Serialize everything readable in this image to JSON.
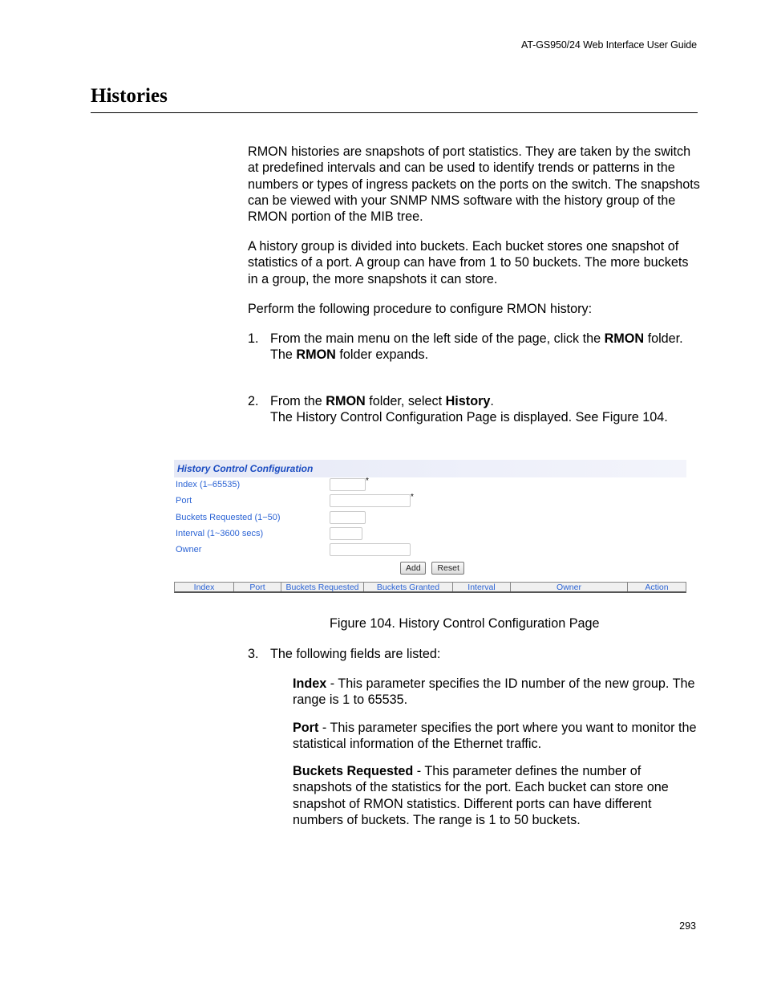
{
  "running_header": "AT-GS950/24  Web Interface User Guide",
  "section_title": "Histories",
  "paragraphs": [
    "RMON histories are snapshots of port statistics. They are taken by the switch at predefined intervals and can be used to identify trends or patterns in the numbers or types of ingress packets on the ports on the switch. The snapshots can be viewed with your SNMP NMS software with the history group of the RMON portion of the MIB tree.",
    "A history group is divided into buckets. Each bucket stores one snapshot of statistics of a port. A group can have from 1 to 50 buckets. The more buckets in a group, the more snapshots it can store.",
    "Perform the following procedure to configure RMON history:"
  ],
  "steps": [
    {
      "number": "1.",
      "line1_pre": "From the main menu on the left side of the page, click the ",
      "line1_bold": "RMON",
      "line1_post": " folder.",
      "line2_pre": "The ",
      "line2_bold": "RMON",
      "line2_post": " folder expands."
    },
    {
      "number": "2.",
      "line1_pre": "From the ",
      "line1_bold": "RMON",
      "line1_mid": " folder, select ",
      "line1_bold2": "History",
      "line1_post": ".",
      "line2": "The History Control Configuration Page is displayed. See Figure 104."
    },
    {
      "number": "3.",
      "text": "The following fields are listed:"
    }
  ],
  "figure": {
    "header": "History Control Configuration",
    "fields": [
      {
        "label": "Index (1–65535)",
        "value": "",
        "required": "*"
      },
      {
        "label": "Port",
        "value": "",
        "required": "*"
      },
      {
        "label": "Buckets Requested (1−50)",
        "value": "",
        "required": ""
      },
      {
        "label": "Interval (1~3600 secs)",
        "value": "",
        "required": ""
      },
      {
        "label": "Owner",
        "value": "",
        "required": ""
      }
    ],
    "buttons": {
      "add": "Add",
      "reset": "Reset"
    },
    "table_columns": [
      "Index",
      "Port",
      "Buckets Requested",
      "Buckets Granted",
      "Interval",
      "Owner",
      "Action"
    ],
    "caption": "Figure 104. History Control Configuration Page"
  },
  "field_descriptions": [
    {
      "term": "Index",
      "text": " - This parameter specifies the ID number of the new group. The range is 1 to 65535."
    },
    {
      "term": "Port",
      "text": " - This parameter specifies the port where you want to monitor the statistical information of the Ethernet traffic."
    },
    {
      "term": "Buckets Requested",
      "text": " - This parameter defines the number of snapshots of the statistics for the port. Each bucket can store one snapshot of RMON statistics. Different ports can have different numbers of buckets. The range is 1 to 50 buckets."
    }
  ],
  "page_number": "293"
}
